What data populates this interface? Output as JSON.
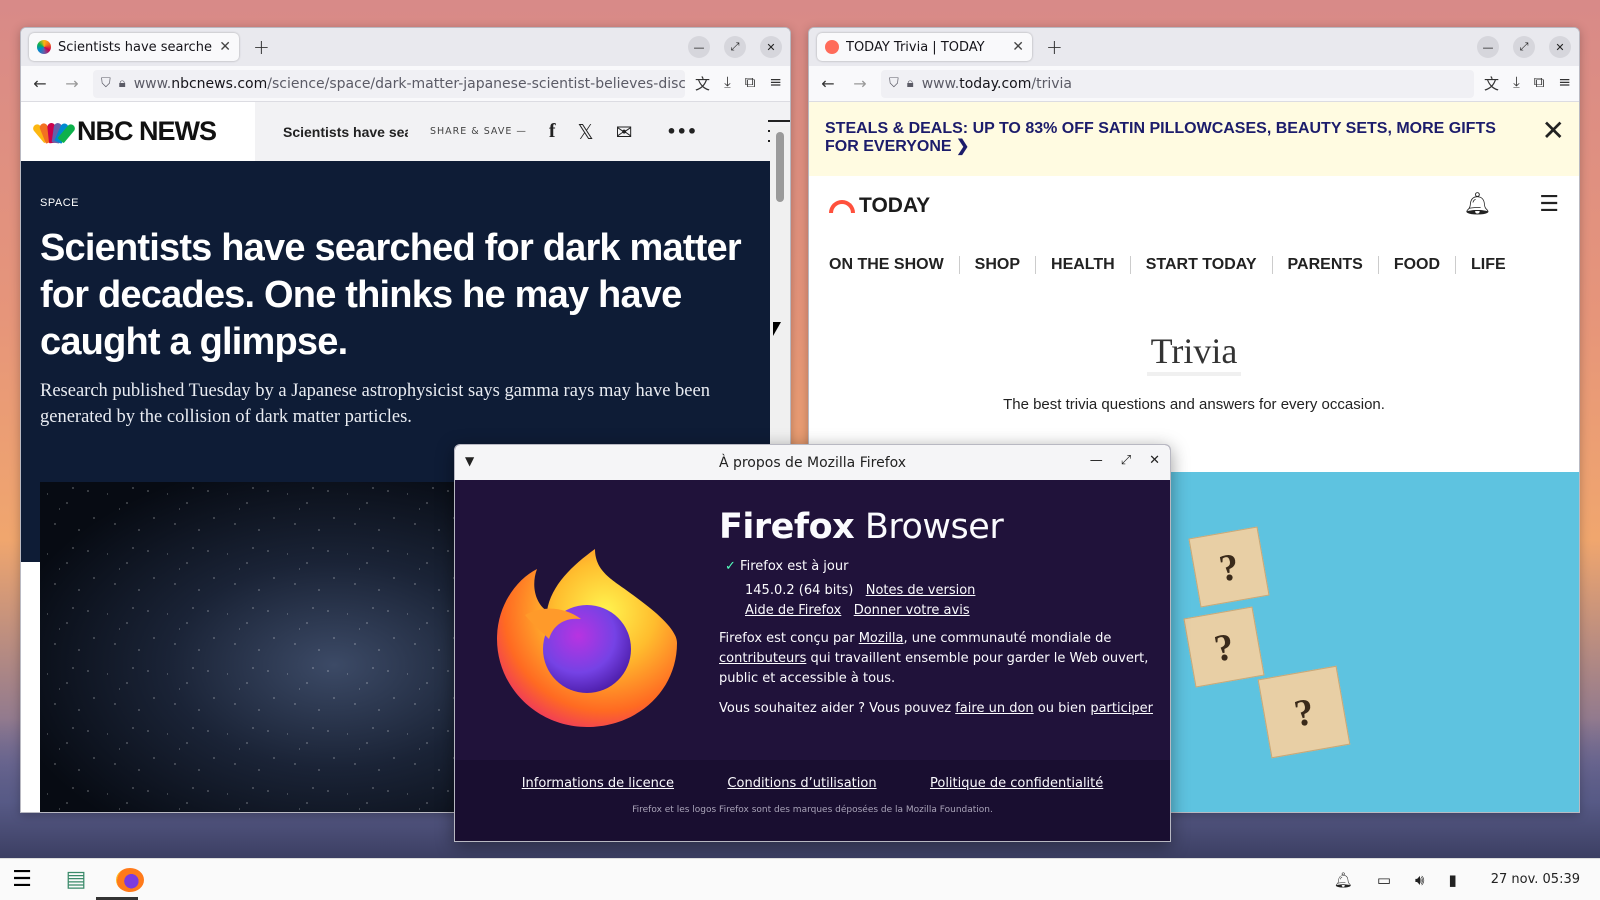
{
  "nbc_window": {
    "tab_title": "Scientists have searched f",
    "url_prefix": "www.",
    "url_domain": "nbcnews.com",
    "url_path": "/science/space/dark-matter-japanese-scientist-believes-disc",
    "brand": "NBC NEWS",
    "strip_title": "Scientists have sear",
    "share_label": "SHARE & SAVE —",
    "more_label": "•••",
    "category": "SPACE",
    "headline": "Scientists have searched for dark matter for decades. One thinks he may have caught a glimpse.",
    "dek": "Research published Tuesday by a Japanese astrophysicist says gamma rays may have been generated by the collision of dark matter particles."
  },
  "today_window": {
    "tab_title": "TODAY Trivia | TODAY",
    "url_prefix": "www.",
    "url_domain": "today.com",
    "url_path": "/trivia",
    "banner": "STEALS & DEALS: UP TO 83% OFF SATIN PILLOWCASES, BEAUTY SETS, MORE GIFTS FOR EVERYONE ❯",
    "brand": "TODAY",
    "nav": [
      "ON THE SHOW",
      "SHOP",
      "HEALTH",
      "START TODAY",
      "PARENTS",
      "FOOD",
      "LIFE"
    ],
    "page_title": "Trivia",
    "page_subtitle": "The best trivia questions and answers for every occasion."
  },
  "about_dialog": {
    "title": "À propos de Mozilla Firefox",
    "brand_bold": "Firefox",
    "brand_light": " Browser",
    "status": "Firefox est à jour",
    "version": "145.0.2 (64 bits)",
    "release_notes": "Notes de version",
    "help": "Aide de Firefox",
    "feedback": "Donner votre avis",
    "para1_a": "Firefox est conçu par ",
    "para1_link1": "Mozilla",
    "para1_b": ", une communauté mondiale de",
    "para1_link2": "contributeurs",
    "para1_c": " qui travaillent ensemble pour garder le Web ouvert, public et accessible à tous.",
    "para2_a": "Vous souhaitez aider ? Vous pouvez ",
    "para2_link1": "faire un don",
    "para2_b": " ou bien ",
    "para2_link2": "participer",
    "footer_links": [
      "Informations de licence",
      "Conditions d’utilisation",
      "Politique de confidentialité"
    ],
    "trademark": "Firefox et les logos Firefox sont des marques déposées de la Mozilla Foundation."
  },
  "taskbar": {
    "clock": "27 nov. 05:39"
  },
  "colors": {
    "nbc_hero": "#0e1c36",
    "today_banner": "#fffbe1",
    "firefox_dialog": "#20123a"
  }
}
